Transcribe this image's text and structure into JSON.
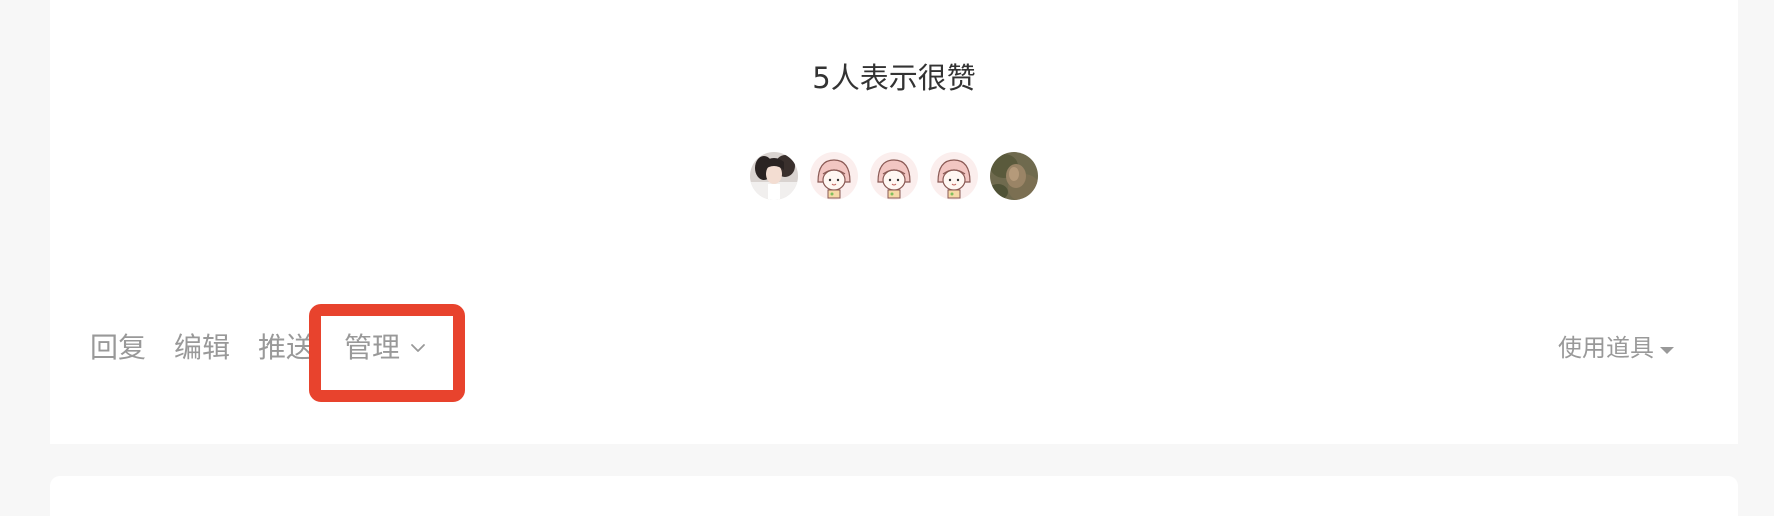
{
  "likes": {
    "summary": "5人表示很赞",
    "avatars": [
      {
        "name": "user-avatar-photo"
      },
      {
        "name": "user-avatar-cartoon-girl"
      },
      {
        "name": "user-avatar-cartoon-girl"
      },
      {
        "name": "user-avatar-cartoon-girl"
      },
      {
        "name": "user-avatar-nature-photo"
      }
    ]
  },
  "actions": {
    "reply": "回复",
    "edit": "编辑",
    "push": "推送",
    "manage": "管理"
  },
  "tools": {
    "label": "使用道具"
  },
  "colors": {
    "highlight": "#e8432d",
    "muted_text": "#999999",
    "title_text": "#333333"
  },
  "icons": {
    "manage_chevron": "chevron-down-icon",
    "tools_caret": "caret-down-icon"
  }
}
